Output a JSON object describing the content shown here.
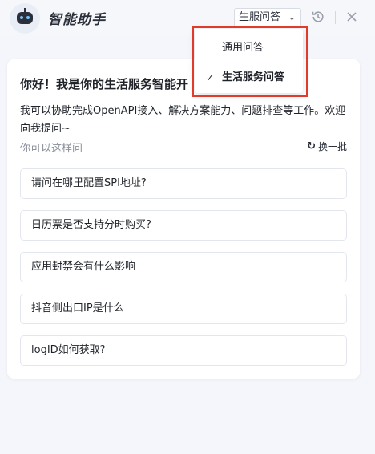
{
  "header": {
    "title": "智能助手",
    "mode_select_value": "生服问答"
  },
  "dropdown": {
    "options": [
      {
        "label": "通用问答",
        "selected": false
      },
      {
        "label": "生活服务问答",
        "selected": true
      }
    ],
    "check_mark": "✓"
  },
  "card": {
    "greeting": "你好！我是你的生活服务智能开",
    "intro": "我可以协助完成OpenAPI接入、解决方案能力、问题排查等工作。欢迎向我提问~",
    "ask_hint": "你可以这样问",
    "refresh_label": "换一批",
    "questions": [
      "请问在哪里配置SPI地址?",
      "日历票是否支持分时购买?",
      "应用封禁会有什么影响",
      "抖音侧出口IP是什么",
      "logID如何获取?"
    ]
  },
  "colors": {
    "highlight": "#e03c2b",
    "background": "#f4f6fb"
  },
  "icons": [
    "robot-logo-icon",
    "chevron-down-icon",
    "history-icon",
    "close-icon",
    "refresh-icon",
    "check-icon"
  ]
}
